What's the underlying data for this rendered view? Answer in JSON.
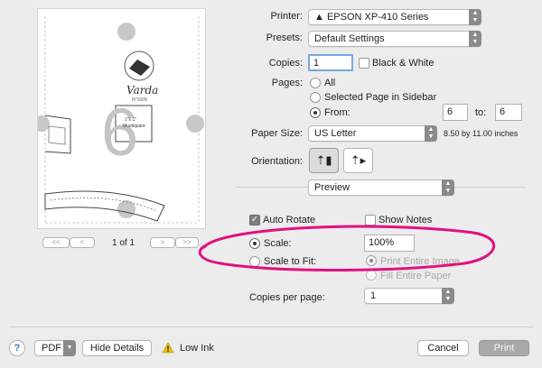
{
  "preview": {
    "brand": "Varda",
    "code": "N°1009",
    "big_number": "6",
    "box_label": "1\"x 1\"",
    "box_sublabel": "Mustiquare",
    "page_indicator": "1 of 1",
    "nav_first": "<<",
    "nav_prev": "<",
    "nav_next": ">",
    "nav_last": ">>"
  },
  "form": {
    "printer_label": "Printer:",
    "printer_value": "▲ EPSON XP-410 Series",
    "presets_label": "Presets:",
    "presets_value": "Default Settings",
    "copies_label": "Copies:",
    "copies_value": "1",
    "bw_label": "Black & White",
    "pages_label": "Pages:",
    "pages_all": "All",
    "pages_selected": "Selected Page in Sidebar",
    "pages_from": "From:",
    "from_value": "6",
    "to_label": "to:",
    "to_value": "6",
    "paper_label": "Paper Size:",
    "paper_value": "US Letter",
    "paper_dims": "8.50 by 11.00 inches",
    "orientation_label": "Orientation:",
    "section_value": "Preview",
    "auto_rotate": "Auto Rotate",
    "show_notes": "Show Notes",
    "scale_label": "Scale:",
    "scale_value": "100%",
    "scale_to_fit": "Scale to Fit:",
    "print_entire": "Print Entire Image",
    "fill_entire": "Fill Entire Paper",
    "copies_per_page_label": "Copies per page:",
    "copies_per_page_value": "1"
  },
  "footer": {
    "help": "?",
    "pdf": "PDF",
    "hide_details": "Hide Details",
    "low_ink": "Low Ink",
    "cancel": "Cancel",
    "print": "Print"
  },
  "annotation": {
    "color": "#e0117f"
  }
}
